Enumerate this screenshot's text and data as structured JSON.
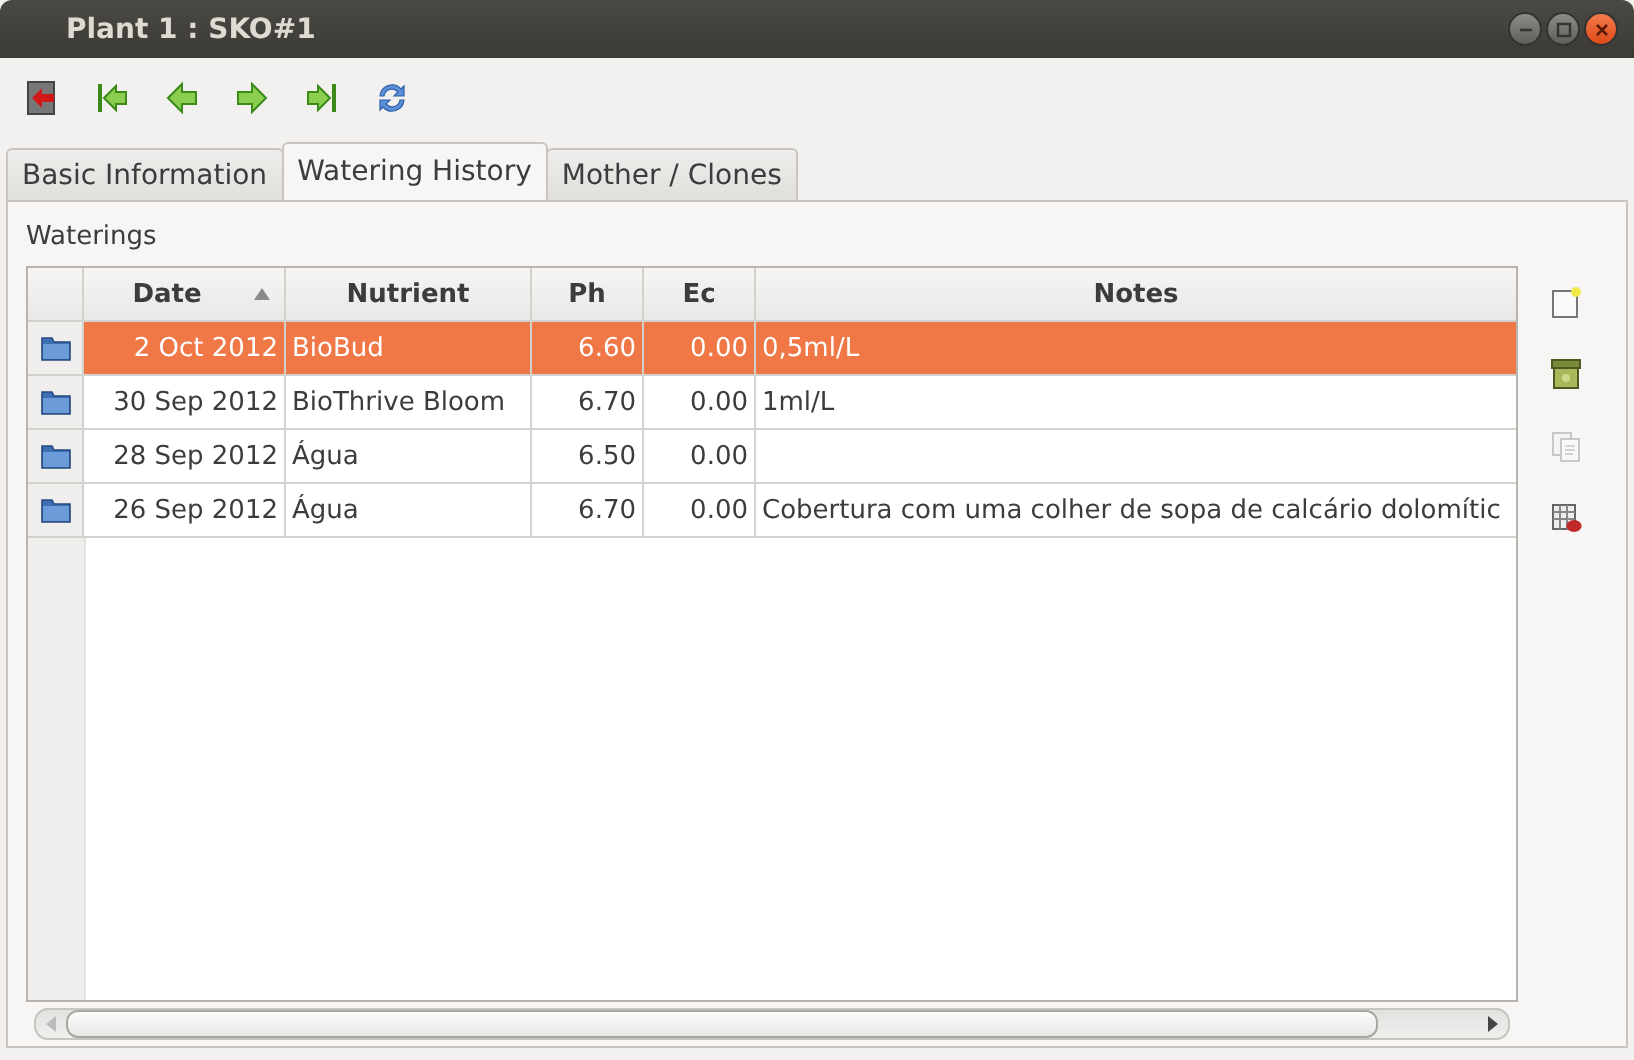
{
  "window": {
    "title": "Plant 1 : SKO#1"
  },
  "toolbar": [
    {
      "kind": "exit"
    },
    {
      "kind": "first"
    },
    {
      "kind": "prev"
    },
    {
      "kind": "next"
    },
    {
      "kind": "last"
    },
    {
      "kind": "refresh"
    }
  ],
  "tabs": [
    {
      "label": "Basic Information",
      "selected": false
    },
    {
      "label": "Watering History",
      "selected": true
    },
    {
      "label": "Mother / Clones",
      "selected": false
    }
  ],
  "section_label": "Waterings",
  "table": {
    "columns": [
      {
        "label": "Date",
        "sorted": true
      },
      {
        "label": "Nutrient",
        "sorted": false
      },
      {
        "label": "Ph",
        "sorted": false
      },
      {
        "label": "Ec",
        "sorted": false
      },
      {
        "label": "Notes",
        "sorted": false
      }
    ],
    "rows": [
      {
        "date": "2 Oct 2012",
        "nutrient": "BioBud",
        "ph": "6.60",
        "ec": "0.00",
        "notes": "0,5ml/L",
        "selected": true
      },
      {
        "date": "30 Sep 2012",
        "nutrient": "BioThrive Bloom",
        "ph": "6.70",
        "ec": "0.00",
        "notes": "1ml/L",
        "selected": false
      },
      {
        "date": "28 Sep 2012",
        "nutrient": "Água",
        "ph": "6.50",
        "ec": "0.00",
        "notes": "",
        "selected": false
      },
      {
        "date": "26 Sep 2012",
        "nutrient": "Água",
        "ph": "6.70",
        "ec": "0.00",
        "notes": "Cobertura com uma colher de sopa de calcário dolomític",
        "selected": false
      }
    ]
  },
  "side_buttons": [
    {
      "kind": "new",
      "disabled": false
    },
    {
      "kind": "archive",
      "disabled": false
    },
    {
      "kind": "copy",
      "disabled": true
    },
    {
      "kind": "delete",
      "disabled": false
    }
  ]
}
